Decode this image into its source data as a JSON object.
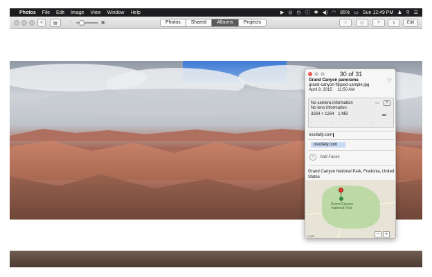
{
  "menubar": {
    "apple": "",
    "items": [
      "Photos",
      "File",
      "Edit",
      "Image",
      "View",
      "Window",
      "Help"
    ],
    "battery": "85%",
    "clock": "Sun 12:49 PM"
  },
  "toolbar": {
    "back_glyph": "<",
    "tabs": [
      {
        "label": "Photos",
        "active": false
      },
      {
        "label": "Shared",
        "active": false
      },
      {
        "label": "Albums",
        "active": true
      },
      {
        "label": "Projects",
        "active": false
      }
    ],
    "edit_label": "Edit",
    "plus_glyph": "+"
  },
  "info": {
    "counter": "30 of 31",
    "title": "Grand Canyon panorama",
    "filename": "grand-canyon-flipped-sample.jpg",
    "date": "April 9, 2015",
    "time": "11:50 AM",
    "camera": {
      "line1": "No camera information",
      "line2": "No lens information",
      "size": "3264 × 1264",
      "filesize": "1 MB",
      "badge": "?",
      "dashes": [
        "-",
        "-",
        "-",
        "-",
        "-"
      ]
    },
    "caption": "osxdaily.com",
    "keyword": "osxdaily.com",
    "add_faces": "Add Faces",
    "location": "Grand Canyon National Park, Fredonia, United States",
    "map": {
      "park_label": "Grand Canyon National Park",
      "legal": "Legal",
      "zoom_out": "−",
      "zoom_in": "+"
    }
  }
}
